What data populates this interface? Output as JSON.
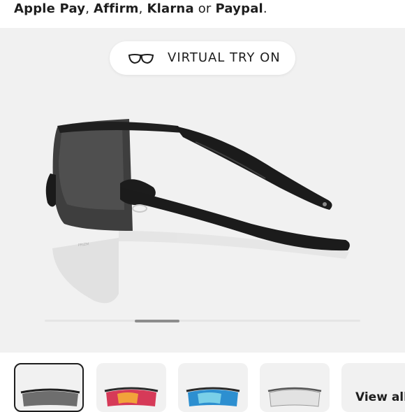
{
  "payment": {
    "option1": "Apple Pay",
    "sep1": ", ",
    "option2": "Affirm",
    "sep2": ", ",
    "option3": "Klarna",
    "sep3": " or ",
    "option4": "Paypal",
    "end": "."
  },
  "gallery": {
    "virtual_try_on_label": "VIRTUAL TRY ON",
    "vto_icon": "glasses-outline-icon",
    "lens_brand_text": "PRIZM"
  },
  "thumbnails": {
    "items": [
      {
        "name": "black-prizm",
        "lens_color": "#6e6e6e",
        "selected": true
      },
      {
        "name": "ruby-prizm",
        "lens_color": "#d63a58",
        "selected": false
      },
      {
        "name": "sapphire-prizm",
        "lens_color": "#2d8fd0",
        "selected": false
      },
      {
        "name": "clear-photochromic",
        "lens_color": "#d9d9d9",
        "selected": false
      }
    ],
    "view_all_label": "View all"
  },
  "colors": {
    "text": "#1e1e1e",
    "gallery_bg": "#f1f1f1",
    "scroll_thumb": "#8d8d8d"
  }
}
